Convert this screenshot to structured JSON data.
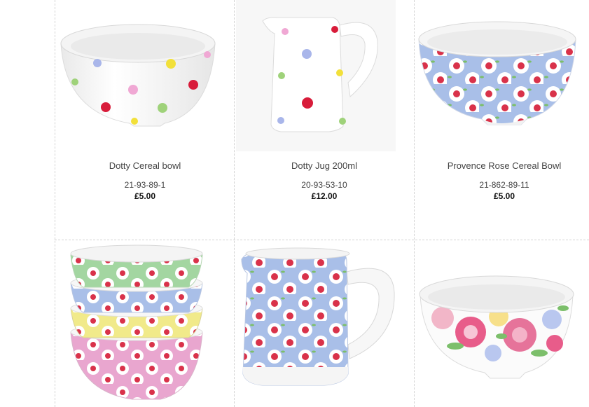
{
  "products": [
    {
      "name": "Dotty Cereal bowl",
      "code": "21-93-89-1",
      "price": "£5.00",
      "image": "dotty-bowl"
    },
    {
      "name": "Dotty Jug 200ml",
      "code": "20-93-53-10",
      "price": "£12.00",
      "image": "dotty-jug"
    },
    {
      "name": "Provence Rose Cereal Bowl",
      "code": "21-862-89-11",
      "price": "£5.00",
      "image": "provence-bowl"
    },
    {
      "name": "",
      "code": "",
      "price": "",
      "image": "stacked-bowls"
    },
    {
      "name": "",
      "code": "",
      "price": "",
      "image": "provence-jug"
    },
    {
      "name": "",
      "code": "",
      "price": "",
      "image": "floral-bowl"
    }
  ],
  "colors": {
    "blue": "#a9bfe8",
    "pink": "#e9a6cf",
    "green": "#a3d6a1",
    "yellow": "#f1ea8a",
    "rose": "#d9324a",
    "dot_red": "#d81c3a",
    "dot_yellow": "#f2e03a",
    "dot_green": "#9fd27a",
    "dot_blue": "#a9b6ea",
    "dot_pink": "#f0a8d4"
  }
}
